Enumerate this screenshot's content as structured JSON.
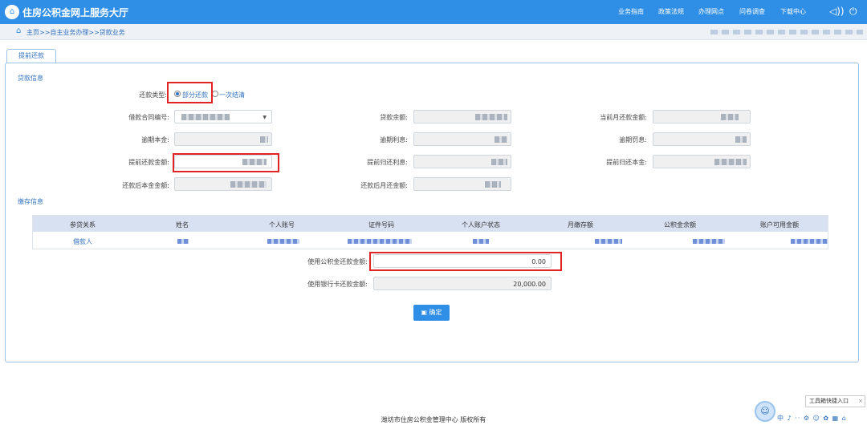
{
  "header": {
    "site_title": "住房公积金网上服务大厅",
    "nav": [
      "业务指南",
      "政策法规",
      "办理网点",
      "问卷调查",
      "下载中心"
    ],
    "icons": [
      "volume-icon",
      "power-icon"
    ]
  },
  "breadcrumb": {
    "text": "主页>>自主业务办理>>贷款业务"
  },
  "tab": {
    "label": "提前还款"
  },
  "loan_info": {
    "section_title": "贷款信息",
    "repay_type_label": "还款类型:",
    "repay_options": [
      "部分还款",
      "一次结清"
    ],
    "selected_option": "部分还款",
    "fields": {
      "contract_no": "借款合同编号:",
      "loan_balance": "贷款余额:",
      "current_month_due": "当前月还款金额:",
      "overdue_principal": "逾期本金:",
      "overdue_interest": "逾期利息:",
      "overdue_penalty": "逾期罚息:",
      "prepay_amount": "提前还款金额:",
      "prepay_interest": "提前归还利息:",
      "prepay_principal": "提前归还本金:",
      "principal_after": "还款后本金金额:",
      "monthly_after": "还款后月还金额:"
    }
  },
  "deposit_info": {
    "section_title": "缴存信息",
    "columns": [
      "参贷关系",
      "姓名",
      "个人账号",
      "证件号码",
      "个人账户状态",
      "月缴存额",
      "公积金余额",
      "账户可用金额"
    ],
    "row": {
      "relation": "借款人"
    }
  },
  "payment": {
    "fund_label": "使用公积金还款金额:",
    "fund_value": "0.00",
    "bank_label": "使用银行卡还款金额:",
    "bank_value": "20,000.00"
  },
  "confirm_button": "确定",
  "footer": "潍坊市住房公积金管理中心 版权所有",
  "toolbox": {
    "label": "工具箱快捷入口",
    "close": "×"
  },
  "tray_text": "中 ♪ ·· ⚙ ☺ ✿ ▦ ⌂"
}
